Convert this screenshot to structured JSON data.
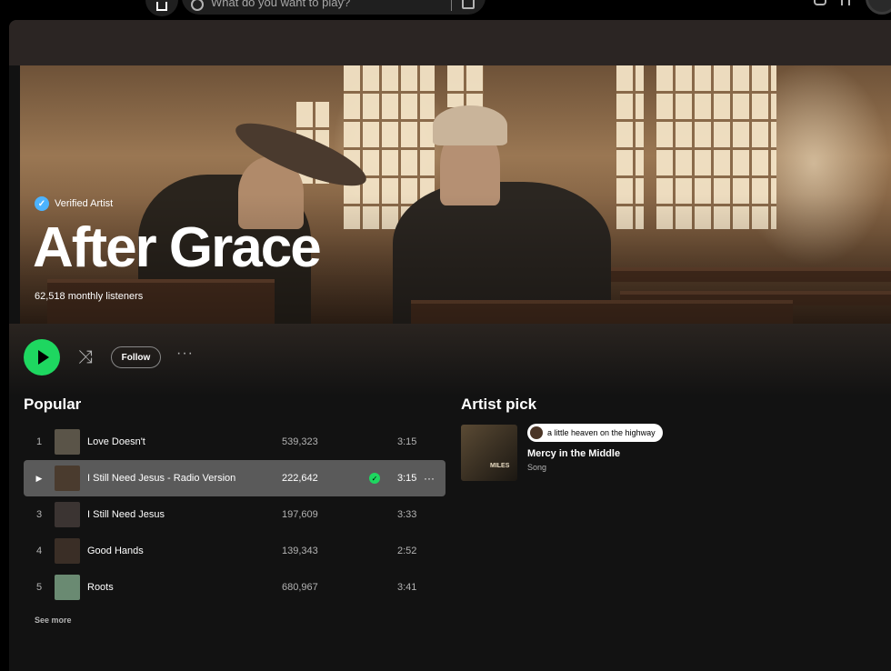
{
  "search": {
    "placeholder": "What do you want to play?"
  },
  "artist": {
    "verified_label": "Verified Artist",
    "name": "After Grace",
    "listeners": "62,518 monthly listeners"
  },
  "actions": {
    "follow_label": "Follow",
    "more_label": "···"
  },
  "popular": {
    "title": "Popular",
    "see_more": "See more",
    "tracks": [
      {
        "num": "1",
        "title": "Love Doesn't",
        "plays": "539,323",
        "duration": "3:15",
        "art_color": "#5a5448"
      },
      {
        "num": "▶",
        "title": "I Still Need Jesus - Radio Version",
        "plays": "222,642",
        "duration": "3:15",
        "art_color": "#4a3b2e"
      },
      {
        "num": "3",
        "title": "I Still Need Jesus",
        "plays": "197,609",
        "duration": "3:33",
        "art_color": "#3b3432"
      },
      {
        "num": "4",
        "title": "Good Hands",
        "plays": "139,343",
        "duration": "2:52",
        "art_color": "#3a2e26"
      },
      {
        "num": "5",
        "title": "Roots",
        "plays": "680,967",
        "duration": "3:41",
        "art_color": "#6a8a72"
      }
    ]
  },
  "artist_pick": {
    "title": "Artist pick",
    "pill": "a little heaven on the highway",
    "name": "Mercy in the Middle",
    "type": "Song",
    "art_text": "MILES"
  },
  "colors": {
    "accent": "#1ed760",
    "verified": "#4cb3ff",
    "background": "#121212"
  }
}
